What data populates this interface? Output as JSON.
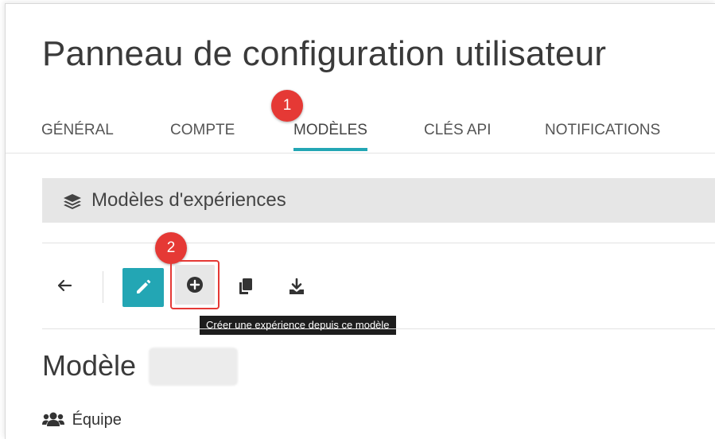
{
  "page": {
    "title": "Panneau de configuration utilisateur"
  },
  "tabs": [
    {
      "label": "GÉNÉRAL",
      "active": false
    },
    {
      "label": "COMPTE",
      "active": false
    },
    {
      "label": "MODÈLES",
      "active": true
    },
    {
      "label": "CLÉS API",
      "active": false
    },
    {
      "label": "NOTIFICATIONS",
      "active": false
    }
  ],
  "markers": {
    "step1": "1",
    "step2": "2"
  },
  "section": {
    "title": "Modèles d'expériences",
    "icon": "layers-icon"
  },
  "toolbar": {
    "back_icon": "arrow-left-icon",
    "edit_icon": "pencil-icon",
    "create_icon": "plus-circle-icon",
    "duplicate_icon": "copy-icon",
    "download_icon": "download-icon",
    "tooltip": "Créer une expérience depuis ce modèle"
  },
  "model": {
    "heading": "Modèle"
  },
  "team": {
    "label": "Équipe",
    "icon": "users-icon"
  },
  "colors": {
    "accent": "#23a6b4",
    "marker": "#e53935",
    "section_bg": "#e6e6e6",
    "tooltip_bg": "#1d1d1d"
  }
}
